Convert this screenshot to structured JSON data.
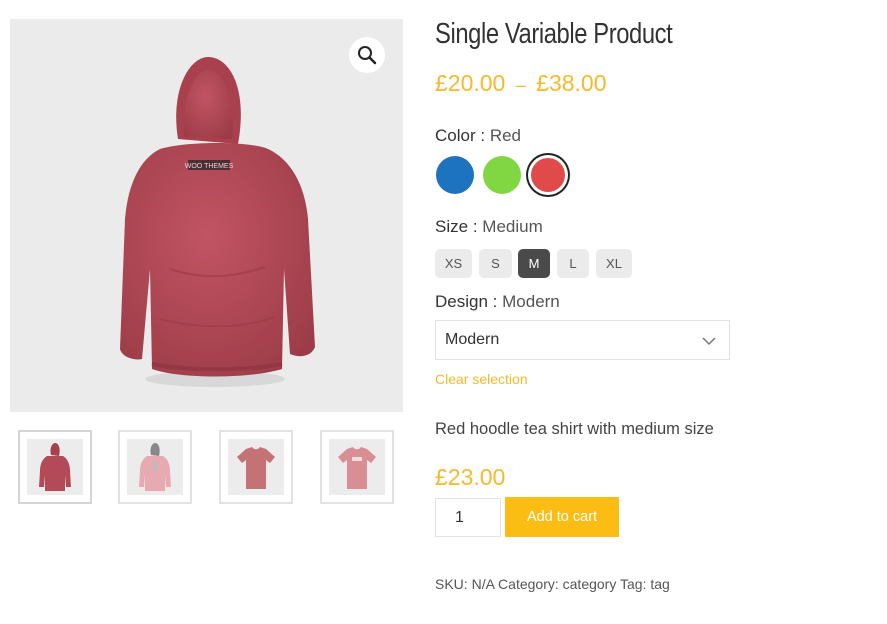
{
  "product": {
    "title": "Single Variable Product",
    "price_min": "£20.00",
    "price_sep": "–",
    "price_max": "£38.00",
    "description": "Red hoodle tea shirt with medium size",
    "variation_price": "£23.00"
  },
  "attributes": {
    "color": {
      "label": "Color",
      "sep": ":",
      "value": "Red",
      "options": [
        {
          "name": "Blue",
          "hex": "#1e73be",
          "selected": false
        },
        {
          "name": "Green",
          "hex": "#81d742",
          "selected": false
        },
        {
          "name": "Red",
          "hex": "#dd3333",
          "selected": true
        }
      ]
    },
    "size": {
      "label": "Size",
      "sep": ":",
      "value": "Medium",
      "options": [
        "XS",
        "S",
        "M",
        "L",
        "XL"
      ],
      "selected": "M"
    },
    "design": {
      "label": "Design",
      "sep": ":",
      "value": "Modern",
      "selected_option": "Modern"
    }
  },
  "clear_selection": "Clear selection",
  "cart": {
    "quantity": "1",
    "add_label": "Add to cart"
  },
  "meta": {
    "sku_label": "SKU:",
    "sku_value": "N/A",
    "category_label": "Category:",
    "category_value": "category",
    "tag_label": "Tag:",
    "tag_value": "tag"
  },
  "icons": {
    "zoom": "magnifier-icon",
    "select": "chevron-down-icon"
  },
  "logo_text": "WOO THEMES",
  "colors": {
    "accent": "#f5b92c",
    "button": "#fbbd14",
    "hoodie_red": "#b64a57",
    "tshirt_pink": "#d68a8f"
  }
}
